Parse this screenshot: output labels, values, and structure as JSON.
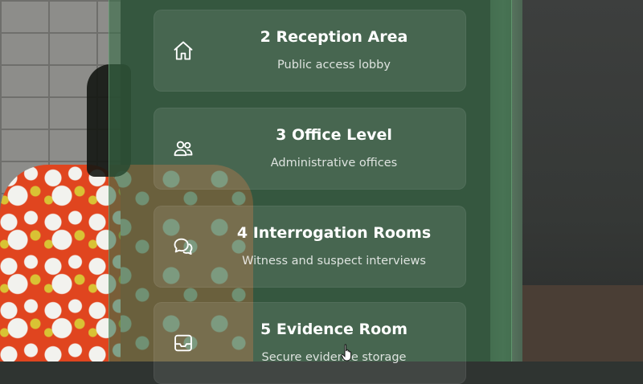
{
  "floors": [
    {
      "title": "2 Reception Area",
      "subtitle": "Public access lobby",
      "icon": "home-icon"
    },
    {
      "title": "3 Office Level",
      "subtitle": "Administrative offices",
      "icon": "users-icon"
    },
    {
      "title": "4 Interrogation Rooms",
      "subtitle": "Witness and suspect interviews",
      "icon": "chat-icon"
    },
    {
      "title": "5 Evidence Room",
      "subtitle": "Secure evidence storage",
      "icon": "archive-box-icon"
    }
  ],
  "colors": {
    "panel": "#3a6e48",
    "card": "#ffffff17",
    "text": "#ffffff"
  }
}
